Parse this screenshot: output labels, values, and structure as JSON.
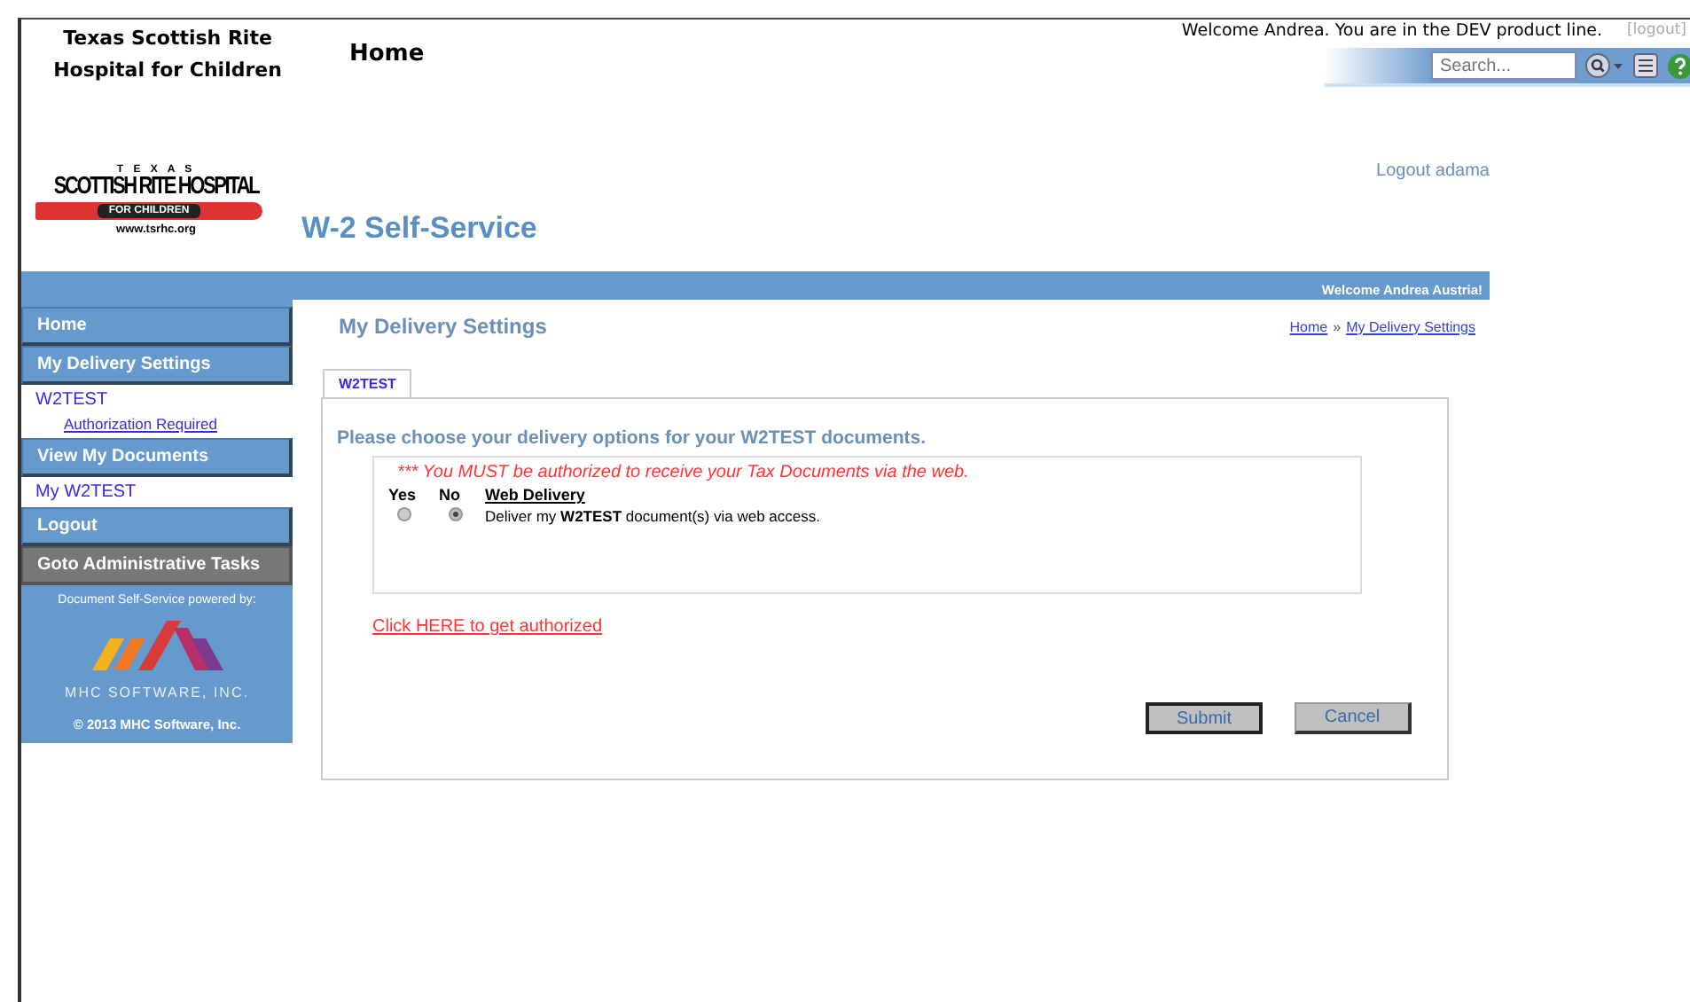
{
  "top_bar": {
    "org_name_lines": [
      "Texas Scottish Rite",
      "Hospital for Children"
    ],
    "home_link": "Home",
    "welcome": "Welcome Andrea. You are in the DEV product line.",
    "logout": "[logout]",
    "search": {
      "placeholder": "Search..."
    }
  },
  "logo": {
    "top": "T E X A S",
    "name": "SCOTTISH RITE HOSPITAL",
    "banner": "FOR CHILDREN",
    "url": "www.tsrhc.org"
  },
  "app_title": "W-2 Self-Service",
  "logout_user": "Logout adama",
  "banner_welcome": "Welcome Andrea Austria!",
  "sidebar": {
    "items": [
      {
        "label": "Home",
        "kind": "header",
        "selected": false
      },
      {
        "label": "My Delivery Settings",
        "kind": "header",
        "selected": false
      },
      {
        "label": "W2TEST",
        "kind": "sub",
        "selected": false,
        "children": [
          {
            "label": "Authorization Required"
          }
        ]
      },
      {
        "label": "View My Documents",
        "kind": "header",
        "selected": false
      },
      {
        "label": "My W2TEST",
        "kind": "sub",
        "selected": false
      },
      {
        "label": "Logout",
        "kind": "header",
        "selected": false
      },
      {
        "label": "Goto Administrative Tasks",
        "kind": "admin",
        "selected": false
      }
    ],
    "powered_by": "Document Self-Service powered by:",
    "vendor": "MHC SOFTWARE, INC.",
    "copyright": "© 2013  MHC Software, Inc."
  },
  "page_title": "My Delivery Settings",
  "breadcrumb": [
    "Home",
    "My Delivery Settings"
  ],
  "breadcrumb_sep": "»",
  "tabs": [
    {
      "label": "W2TEST",
      "selected": true
    }
  ],
  "instruction": "Please choose your delivery options for your W2TEST documents.",
  "warning": "*** You MUST be authorized to receive your Tax Documents via the web.",
  "options_table": {
    "columns": [
      "Yes",
      "No",
      "Web Delivery"
    ],
    "rows": [
      {
        "yes_selected": false,
        "no_selected": true,
        "disabled": true,
        "text": "Deliver my **W2TEST** document(s) via web access."
      }
    ]
  },
  "authorize_link": "Click HERE to get authorized",
  "buttons": [
    {
      "label": "Submit",
      "focused": true
    },
    {
      "label": "Cancel",
      "focused": false
    }
  ]
}
